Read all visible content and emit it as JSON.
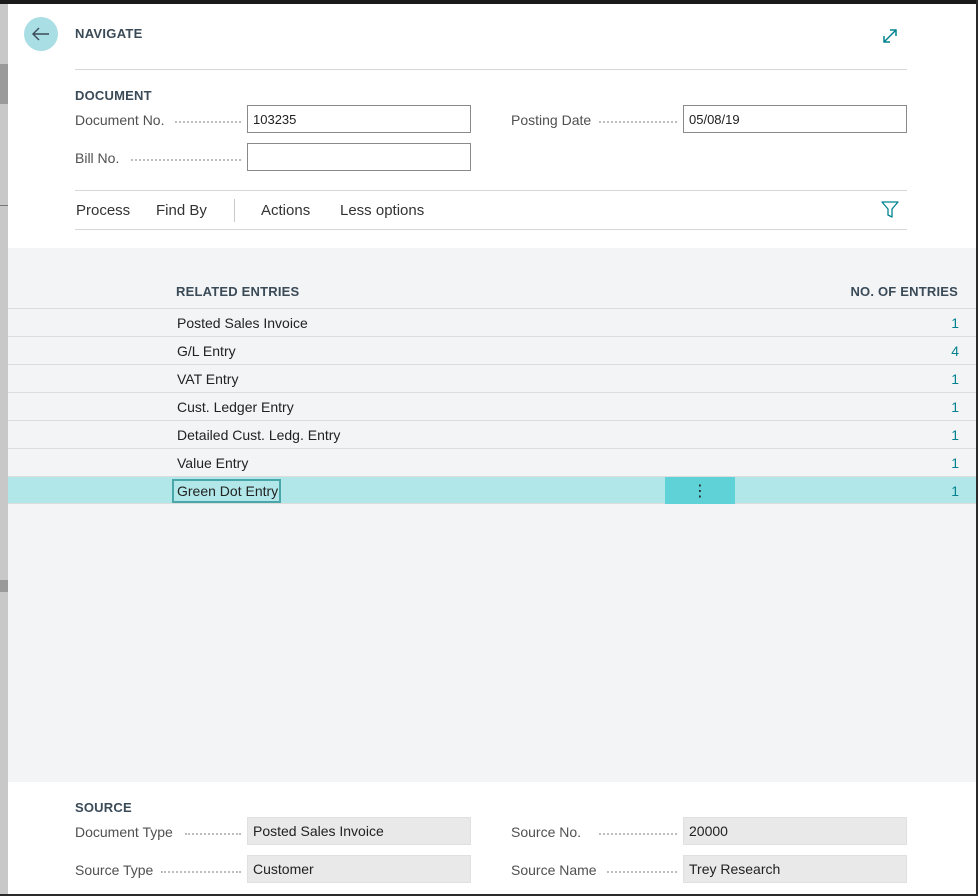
{
  "dialog": {
    "title": "NAVIGATE",
    "back_icon": "arrow-left-icon",
    "expand_icon": "expand-icon"
  },
  "document": {
    "section_title": "DOCUMENT",
    "document_no_label": "Document No.",
    "document_no_value": "103235",
    "posting_date_label": "Posting Date",
    "posting_date_value": "05/08/19",
    "bill_no_label": "Bill No.",
    "bill_no_value": ""
  },
  "actions": {
    "process": "Process",
    "find_by": "Find By",
    "actions": "Actions",
    "less_options": "Less options",
    "filter_icon": "filter-icon"
  },
  "grid": {
    "col_related": "RELATED ENTRIES",
    "col_count": "NO. OF ENTRIES",
    "rows": [
      {
        "name": "Posted Sales Invoice",
        "count": "1"
      },
      {
        "name": "G/L Entry",
        "count": "4"
      },
      {
        "name": "VAT Entry",
        "count": "1"
      },
      {
        "name": "Cust. Ledger Entry",
        "count": "1"
      },
      {
        "name": "Detailed Cust. Ledg. Entry",
        "count": "1"
      },
      {
        "name": "Value Entry",
        "count": "1"
      },
      {
        "name": "Green Dot Entry",
        "count": "1"
      }
    ],
    "row_menu": "⋮"
  },
  "source": {
    "section_title": "SOURCE",
    "document_type_label": "Document Type",
    "document_type_value": "Posted Sales Invoice",
    "source_no_label": "Source No.",
    "source_no_value": "20000",
    "source_type_label": "Source Type",
    "source_type_value": "Customer",
    "source_name_label": "Source Name",
    "source_name_value": "Trey Research"
  },
  "colors": {
    "accent": "#00838f",
    "selected_row": "#b2e7ea",
    "back_button": "#a8dee4"
  }
}
